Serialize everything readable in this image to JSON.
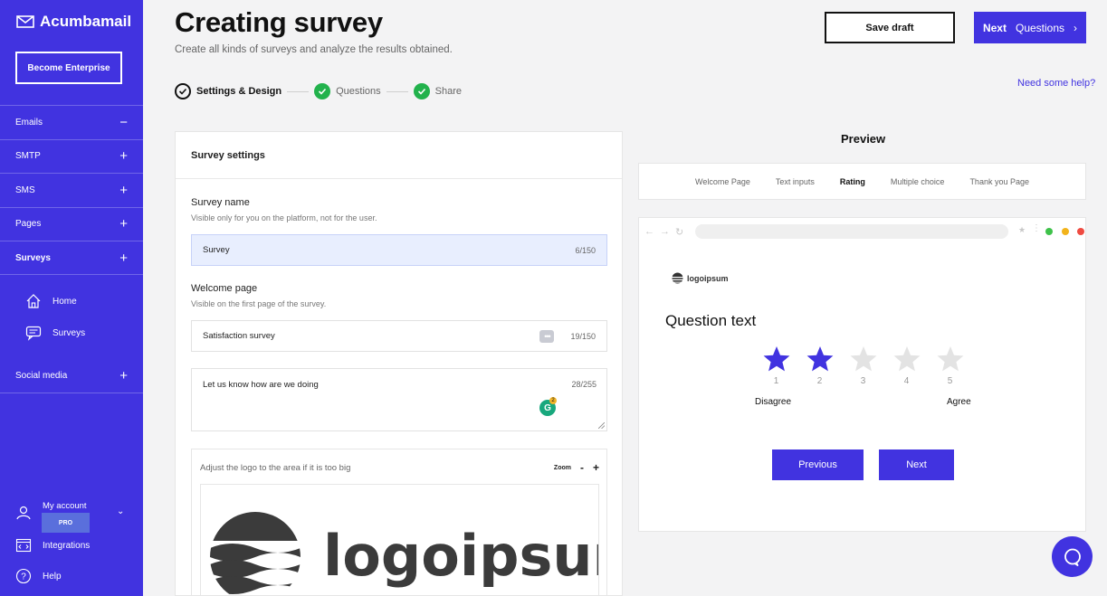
{
  "sidebar": {
    "brand": "Acumbamail",
    "enterprise_button": "Become Enterprise",
    "nav": [
      {
        "label": "Emails",
        "toggle": "−"
      },
      {
        "label": "SMTP",
        "toggle": "+"
      },
      {
        "label": "SMS",
        "toggle": "+"
      },
      {
        "label": "Pages",
        "toggle": "+"
      },
      {
        "label": "Surveys",
        "toggle": "+"
      }
    ],
    "sub_items": [
      {
        "label": "Home",
        "icon": "home-icon"
      },
      {
        "label": "Surveys",
        "icon": "chat-icon"
      }
    ],
    "social": {
      "label": "Social media",
      "toggle": "+"
    },
    "account": {
      "label": "My account",
      "plan": "PRO"
    },
    "integrations": "Integrations",
    "help": "Help"
  },
  "header": {
    "title": "Creating survey",
    "subtitle": "Create all kinds of surveys and analyze the results obtained.",
    "save_draft": "Save draft",
    "next_label": "Next",
    "next_target": "Questions",
    "help_link": "Need some help?"
  },
  "stepper": [
    {
      "label": "Settings & Design",
      "state": "active"
    },
    {
      "label": "Questions",
      "state": "done"
    },
    {
      "label": "Share",
      "state": "done"
    }
  ],
  "settings": {
    "heading": "Survey settings",
    "survey_name": {
      "label": "Survey name",
      "hint": "Visible only for you on the platform, not for the user.",
      "value": "Survey",
      "count": "6/150"
    },
    "welcome": {
      "label": "Welcome page",
      "hint": "Visible on the first page of the survey.",
      "title_value": "Satisfaction survey",
      "title_count": "19/150",
      "body_value": "Let us know how are we doing",
      "body_count": "28/255"
    },
    "grammarly_count": "2",
    "logo": {
      "hint": "Adjust the logo to the area if it is too big",
      "zoom_label": "Zoom",
      "zoom_out": "-",
      "zoom_in": "+",
      "logo_text": "logoipsum"
    }
  },
  "preview": {
    "title": "Preview",
    "tabs": [
      "Welcome Page",
      "Text inputs",
      "Rating",
      "Multiple choice",
      "Thank you Page"
    ],
    "active_tab": "Rating",
    "logo_text": "logoipsum",
    "question": "Question text",
    "rating": {
      "max": 5,
      "selected": 2,
      "labels": [
        "1",
        "2",
        "3",
        "4",
        "5"
      ],
      "low": "Disagree",
      "high": "Agree"
    },
    "previous": "Previous",
    "next": "Next",
    "colors": {
      "accent": "#4133e0",
      "star_empty": "#e3e3e3"
    }
  }
}
